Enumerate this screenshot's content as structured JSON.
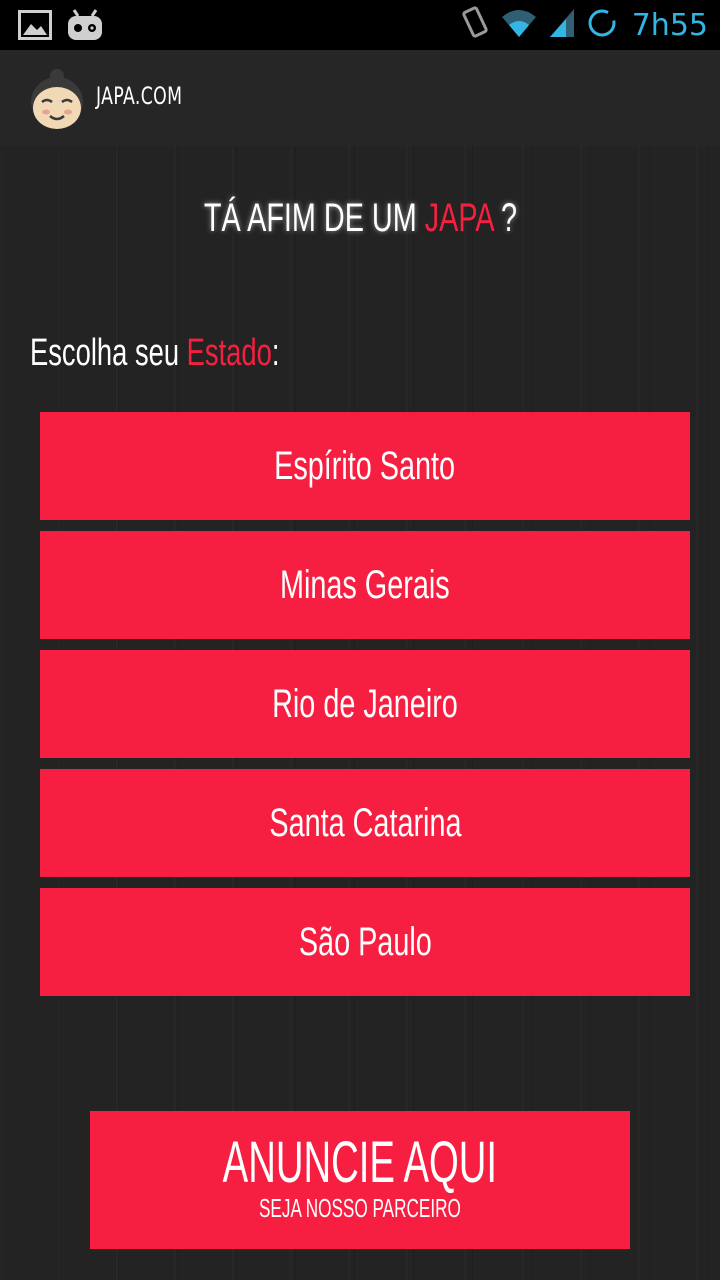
{
  "status_bar": {
    "time": "7h55",
    "icons": [
      "image-icon",
      "android-robot-icon",
      "rotation-icon",
      "wifi-icon",
      "signal-icon",
      "sync-icon"
    ],
    "accent_color": "#33b5e5"
  },
  "action_bar": {
    "title": "JAPA.COM",
    "logo_icon": "sumo-face-icon"
  },
  "main": {
    "headline_prefix": "TÁ AFIM DE UM",
    "headline_accent": "JAPA",
    "headline_suffix": "?",
    "choose_prefix": "Escolha seu",
    "choose_accent": "Estado",
    "choose_suffix": ":",
    "states": [
      {
        "label": "Espírito Santo"
      },
      {
        "label": "Minas Gerais"
      },
      {
        "label": "Rio de Janeiro"
      },
      {
        "label": "Santa Catarina"
      },
      {
        "label": "São Paulo"
      }
    ]
  },
  "ad_banner": {
    "title": "ANUNCIE AQUI",
    "subtitle": "SEJA NOSSO PARCEIRO"
  },
  "colors": {
    "accent": "#f61f41",
    "background": "#232323",
    "text": "#ffffff"
  }
}
